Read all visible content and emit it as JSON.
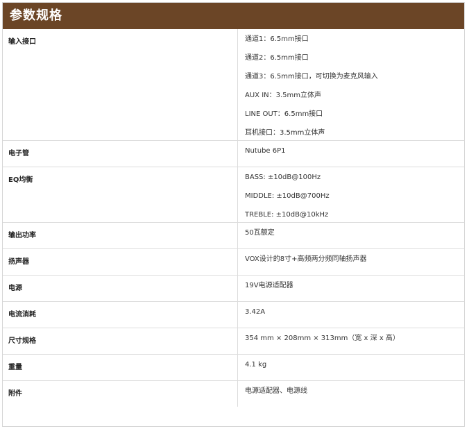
{
  "header": {
    "title": "参数规格"
  },
  "specs": [
    {
      "label": "输入接口",
      "values": [
        "通道1：6.5mm接口",
        "通道2：6.5mm接口",
        "通道3：6.5mm接口，可切换为麦克风输入",
        "AUX IN：3.5mm立体声",
        "LINE OUT：6.5mm接口",
        "耳机接口：3.5mm立体声"
      ]
    },
    {
      "label": "电子管",
      "values": [
        "Nutube 6P1"
      ]
    },
    {
      "label": "EQ均衡",
      "values": [
        "BASS: ±10dB@100Hz",
        "MIDDLE: ±10dB@700Hz",
        "TREBLE: ±10dB@10kHz"
      ]
    },
    {
      "label": "输出功率",
      "values": [
        "50瓦额定"
      ]
    },
    {
      "label": "扬声器",
      "values": [
        "VOX设计的8寸+高频两分频同轴扬声器"
      ]
    },
    {
      "label": "电源",
      "values": [
        "19V电源适配器"
      ]
    },
    {
      "label": "电流消耗",
      "values": [
        "3.42A"
      ]
    },
    {
      "label": "尺寸规格",
      "values": [
        "354 mm × 208mm × 313mm（宽 x 深 x 高）"
      ]
    },
    {
      "label": "重量",
      "values": [
        "4.1 kg"
      ]
    },
    {
      "label": "附件",
      "values": [
        "电源适配器、电源线"
      ]
    }
  ]
}
